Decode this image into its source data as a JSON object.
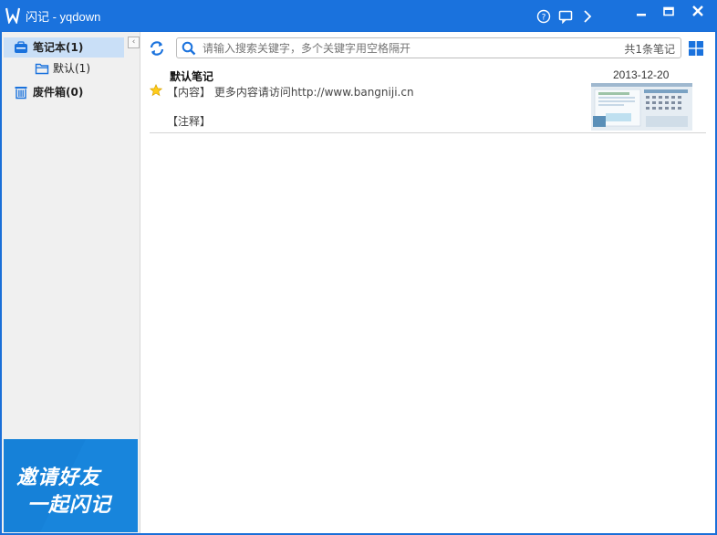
{
  "window": {
    "title": "闪记 - yqdown"
  },
  "titlebar_icons": [
    "help-icon",
    "message-icon",
    "chevron-right-icon"
  ],
  "window_buttons": [
    "minimize",
    "maximize",
    "close"
  ],
  "sidebar": {
    "items": [
      {
        "label": "笔记本(1)",
        "icon": "notebook-icon",
        "selected": true
      },
      {
        "label": "默认(1)",
        "icon": "folder-icon",
        "selected": false
      },
      {
        "label": "废件箱(0)",
        "icon": "trash-icon",
        "selected": false
      }
    ],
    "banner": {
      "line1": "邀请好友",
      "line2": "一起闪记"
    }
  },
  "search": {
    "placeholder": "请输入搜索关键字，多个关键字用空格隔开",
    "value": "",
    "count": "共1条笔记"
  },
  "notes": [
    {
      "title": "默认笔记",
      "date": "2013-12-20",
      "content": "【内容】 更多内容请访问http://www.bangniji.cn",
      "remark": "【注释】",
      "starred": true
    }
  ],
  "colors": {
    "titlebar": "#1a72dd",
    "accent": "#1681d8",
    "selected": "#c9dff7"
  }
}
